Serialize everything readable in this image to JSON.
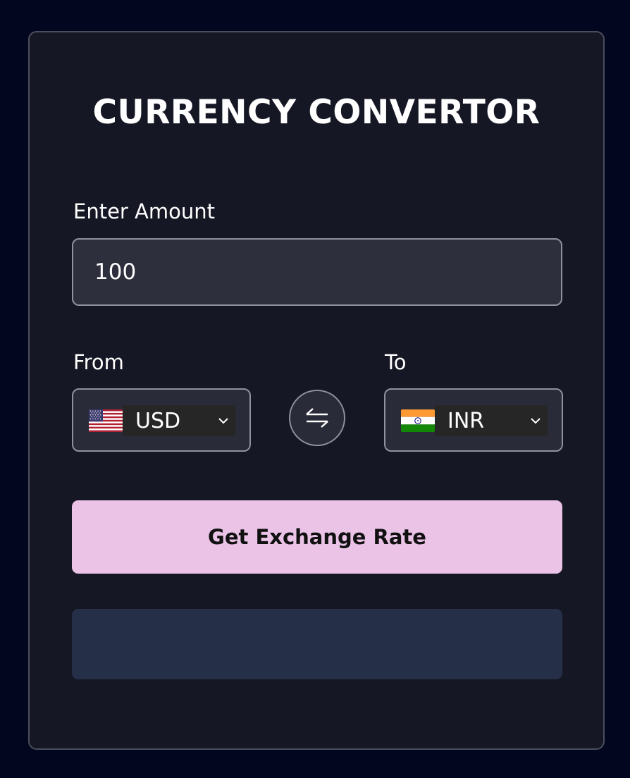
{
  "app": {
    "title": "CURRENCY CONVERTOR"
  },
  "amount": {
    "label": "Enter Amount",
    "value": "100"
  },
  "from": {
    "label": "From",
    "currency": "USD",
    "flag": "us-flag"
  },
  "to": {
    "label": "To",
    "currency": "INR",
    "flag": "india-flag"
  },
  "swap": {
    "icon": "swap-arrows-icon"
  },
  "action": {
    "label": "Get Exchange Rate"
  },
  "result": {
    "text": ""
  },
  "colors": {
    "background": "#03061f",
    "card": "#161724",
    "input": "#2e2f3d",
    "button": "#eac3e6",
    "result": "#252f48"
  }
}
